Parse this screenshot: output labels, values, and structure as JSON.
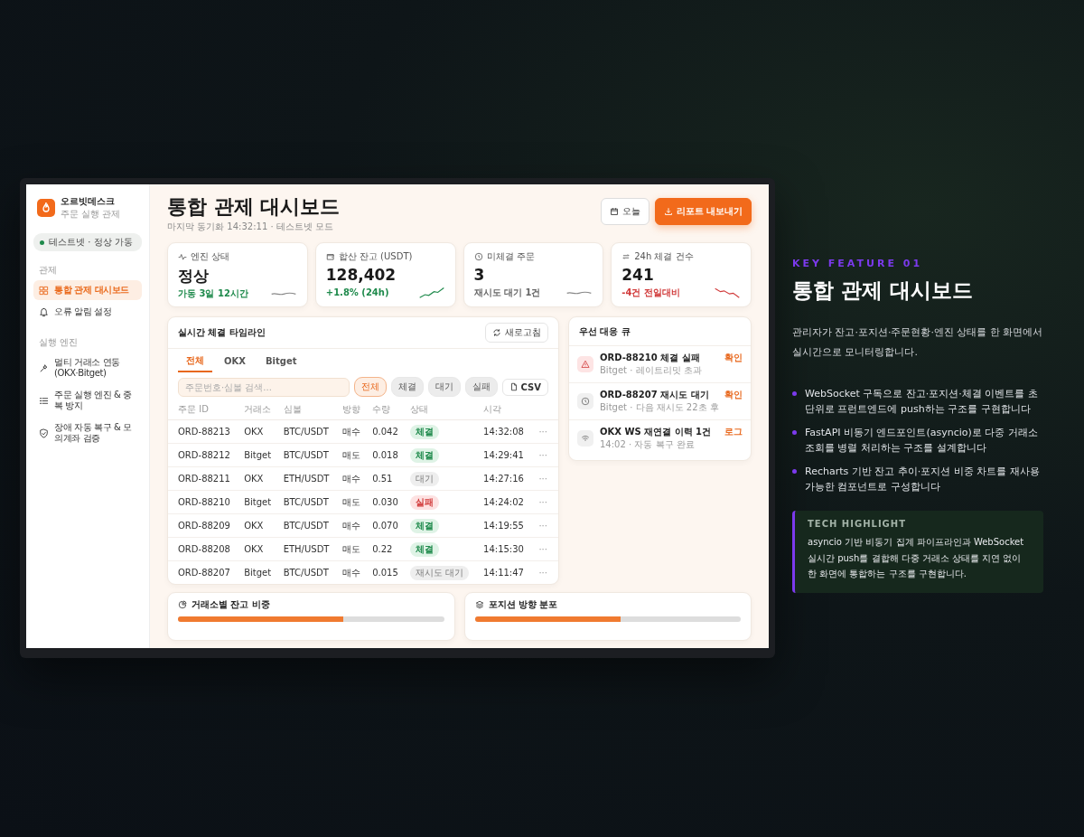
{
  "sidebar": {
    "brand": {
      "name": "오르빗데스크",
      "subtitle": "주문 실행 관제"
    },
    "status": {
      "label": "테스트넷 · 정상 가동",
      "online": true
    },
    "sections": [
      {
        "title": "관제",
        "items": [
          {
            "label": "통합 관제 대시보드",
            "selected": true
          },
          {
            "label": "오류 알림 설정",
            "selected": false
          }
        ]
      },
      {
        "title": "실행 엔진",
        "items": [
          {
            "label": "멀티 거래소 연동 (OKX·Bitget)",
            "selected": false
          },
          {
            "label": "주문 실행 엔진 & 중복 방지",
            "selected": false
          },
          {
            "label": "장애 자동 복구 & 모의계좌 검증",
            "selected": false
          }
        ]
      }
    ]
  },
  "header": {
    "title": "통합 관제 대시보드",
    "subtitle": "마지막 동기화 14:32:11 · 테스트넷 모드",
    "buttons": [
      {
        "label": "오늘",
        "kind": "outline"
      },
      {
        "label": "리포트 내보내기",
        "kind": "primary"
      }
    ]
  },
  "stats": [
    {
      "label": "엔진 상태",
      "value": "정상",
      "note": "가동 3일 12시간",
      "kind": "flat",
      "color": "#1f8a4c"
    },
    {
      "label": "합산 잔고 (USDT)",
      "value": "128,402",
      "note": "+1.8% (24h)",
      "kind": "up",
      "color": "#1f8a4c"
    },
    {
      "label": "미체결 주문",
      "value": "3",
      "note": "재시도 대기 1건",
      "kind": "flat",
      "color": "#666666"
    },
    {
      "label": "24h 체결 건수",
      "value": "241",
      "note": "-4건 전일대비",
      "kind": "down",
      "color": "#d13b3b"
    }
  ],
  "timeline": {
    "title": "실시간 체결 타임라인",
    "refresh": "새로고침",
    "tabs": [
      {
        "label": "전체",
        "selected": true
      },
      {
        "label": "OKX",
        "selected": false
      },
      {
        "label": "Bitget",
        "selected": false
      }
    ],
    "search": {
      "placeholder": "주문번호·심볼 검색..."
    },
    "filters": [
      {
        "label": "전체",
        "selected": true
      },
      {
        "label": "체결",
        "selected": false
      },
      {
        "label": "대기",
        "selected": false
      },
      {
        "label": "실패",
        "selected": false
      }
    ],
    "csv": "CSV",
    "columns": [
      "주문 ID",
      "거래소",
      "심볼",
      "방향",
      "수량",
      "상태",
      "시각"
    ],
    "more": "···",
    "rows": [
      {
        "id": "ORD-88213",
        "exchange": "OKX",
        "symbol": "BTC/USDT",
        "side": "매수",
        "qty": "0.042",
        "status": "체결",
        "kind": "filled",
        "time": "14:32:08"
      },
      {
        "id": "ORD-88212",
        "exchange": "Bitget",
        "symbol": "BTC/USDT",
        "side": "매도",
        "qty": "0.018",
        "status": "체결",
        "kind": "filled",
        "time": "14:29:41"
      },
      {
        "id": "ORD-88211",
        "exchange": "OKX",
        "symbol": "ETH/USDT",
        "side": "매수",
        "qty": "0.51",
        "status": "대기",
        "kind": "pending",
        "time": "14:27:16"
      },
      {
        "id": "ORD-88210",
        "exchange": "Bitget",
        "symbol": "BTC/USDT",
        "side": "매도",
        "qty": "0.030",
        "status": "실패",
        "kind": "failed",
        "time": "14:24:02"
      },
      {
        "id": "ORD-88209",
        "exchange": "OKX",
        "symbol": "BTC/USDT",
        "side": "매수",
        "qty": "0.070",
        "status": "체결",
        "kind": "filled",
        "time": "14:19:55"
      },
      {
        "id": "ORD-88208",
        "exchange": "OKX",
        "symbol": "ETH/USDT",
        "side": "매도",
        "qty": "0.22",
        "status": "체결",
        "kind": "filled",
        "time": "14:15:30"
      },
      {
        "id": "ORD-88207",
        "exchange": "Bitget",
        "symbol": "BTC/USDT",
        "side": "매수",
        "qty": "0.015",
        "status": "재시도 대기",
        "kind": "pending",
        "time": "14:11:47"
      }
    ]
  },
  "queue": {
    "title": "우선 대응 큐",
    "items": [
      {
        "title": "ORD-88210 체결 실패",
        "detail": "Bitget · 레이트리밋 초과",
        "action": "확인",
        "kind": "alert"
      },
      {
        "title": "ORD-88207 재시도 대기",
        "detail": "Bitget · 다음 재시도 22초 후",
        "action": "확인",
        "kind": "clock"
      },
      {
        "title": "OKX WS 재연결 이력 1건",
        "detail": "14:02 · 자동 복구 완료",
        "action": "로그",
        "kind": "wifi"
      }
    ]
  },
  "bottom": [
    {
      "title": "거래소별 잔고 비중",
      "level": 0.62
    },
    {
      "title": "포지션 방향 분포",
      "level": 0.55
    }
  ],
  "feature": {
    "eyebrow": "KEY FEATURE 01",
    "title": "통합 관제 대시보드",
    "description": "관리자가 잔고·포지션·주문현황·엔진 상태를 한 화면에서 실시간으로 모니터링합니다.",
    "bullets": [
      "WebSocket 구독으로 잔고·포지션·체결 이벤트를 초 단위로 프런트엔드에 push하는 구조를 구현합니다",
      "FastAPI 비동기 엔드포인트(asyncio)로 다중 거래소 조회를 병렬 처리하는 구조를 설계합니다",
      "Recharts 기반 잔고 추이·포지션 비중 차트를 재사용 가능한 컴포넌트로 구성합니다"
    ],
    "highlight": {
      "title": "TECH HIGHLIGHT",
      "text": "asyncio 기반 비동기 집계 파이프라인과 WebSocket 실시간 push를 결합해 다중 거래소 상태를 지연 없이 한 화면에 통합하는 구조를 구현합니다."
    }
  }
}
